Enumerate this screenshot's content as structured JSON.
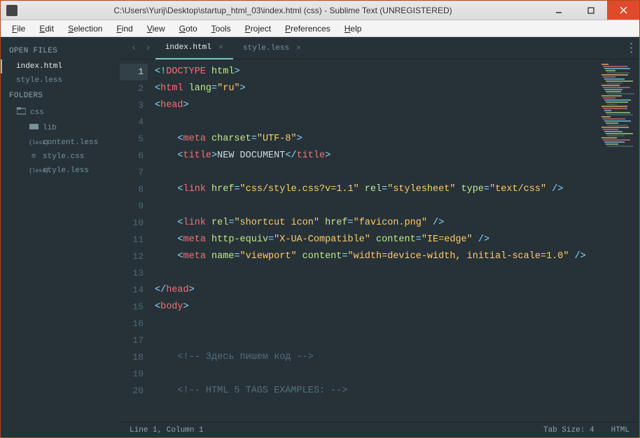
{
  "window": {
    "title": "C:\\Users\\Yurij\\Desktop\\startup_html_03\\index.html (css) - Sublime Text (UNREGISTERED)"
  },
  "menu": [
    "File",
    "Edit",
    "Selection",
    "Find",
    "View",
    "Goto",
    "Tools",
    "Project",
    "Preferences",
    "Help"
  ],
  "sidebar": {
    "open_files_label": "OPEN FILES",
    "open_files": [
      {
        "name": "index.html",
        "active": true
      },
      {
        "name": "style.less",
        "active": false
      }
    ],
    "folders_label": "FOLDERS",
    "tree": [
      {
        "name": "css",
        "icon": "folder-open",
        "indent": 0
      },
      {
        "name": "lib",
        "icon": "folder",
        "indent": 1
      },
      {
        "name": "content.less",
        "icon": "less",
        "indent": 1
      },
      {
        "name": "style.css",
        "icon": "css",
        "indent": 1
      },
      {
        "name": "style.less",
        "icon": "less",
        "indent": 1
      }
    ]
  },
  "tabs": [
    {
      "label": "index.html",
      "active": true
    },
    {
      "label": "style.less",
      "active": false
    }
  ],
  "code_lines": [
    [
      {
        "t": "<!",
        "c": "c-pun"
      },
      {
        "t": "DOCTYPE",
        "c": "c-tag"
      },
      {
        "t": " ",
        "c": ""
      },
      {
        "t": "html",
        "c": "c-attr"
      },
      {
        "t": ">",
        "c": "c-pun"
      }
    ],
    [
      {
        "t": "<",
        "c": "c-pun"
      },
      {
        "t": "html",
        "c": "c-tag"
      },
      {
        "t": " ",
        "c": ""
      },
      {
        "t": "lang",
        "c": "c-attr"
      },
      {
        "t": "=",
        "c": "c-eq"
      },
      {
        "t": "\"ru\"",
        "c": "c-str"
      },
      {
        "t": ">",
        "c": "c-pun"
      }
    ],
    [
      {
        "t": "<",
        "c": "c-pun"
      },
      {
        "t": "head",
        "c": "c-tag"
      },
      {
        "t": ">",
        "c": "c-pun"
      }
    ],
    [
      {
        "t": "",
        "c": ""
      }
    ],
    [
      {
        "t": "    ",
        "c": ""
      },
      {
        "t": "<",
        "c": "c-pun"
      },
      {
        "t": "meta",
        "c": "c-tag"
      },
      {
        "t": " ",
        "c": ""
      },
      {
        "t": "charset",
        "c": "c-attr"
      },
      {
        "t": "=",
        "c": "c-eq"
      },
      {
        "t": "\"UTF-8\"",
        "c": "c-str"
      },
      {
        "t": ">",
        "c": "c-pun"
      }
    ],
    [
      {
        "t": "    ",
        "c": ""
      },
      {
        "t": "<",
        "c": "c-pun"
      },
      {
        "t": "title",
        "c": "c-tag"
      },
      {
        "t": ">",
        "c": "c-pun"
      },
      {
        "t": "NEW DOCUMENT",
        "c": ""
      },
      {
        "t": "</",
        "c": "c-pun"
      },
      {
        "t": "title",
        "c": "c-tag"
      },
      {
        "t": ">",
        "c": "c-pun"
      }
    ],
    [
      {
        "t": "",
        "c": ""
      }
    ],
    [
      {
        "t": "    ",
        "c": ""
      },
      {
        "t": "<",
        "c": "c-pun"
      },
      {
        "t": "link",
        "c": "c-tag"
      },
      {
        "t": " ",
        "c": ""
      },
      {
        "t": "href",
        "c": "c-attr"
      },
      {
        "t": "=",
        "c": "c-eq"
      },
      {
        "t": "\"css/style.css?v=1.1\"",
        "c": "c-str"
      },
      {
        "t": " ",
        "c": ""
      },
      {
        "t": "rel",
        "c": "c-attr"
      },
      {
        "t": "=",
        "c": "c-eq"
      },
      {
        "t": "\"stylesheet\"",
        "c": "c-str"
      },
      {
        "t": " ",
        "c": ""
      },
      {
        "t": "type",
        "c": "c-attr"
      },
      {
        "t": "=",
        "c": "c-eq"
      },
      {
        "t": "\"text/css\"",
        "c": "c-str"
      },
      {
        "t": " />",
        "c": "c-pun"
      }
    ],
    [
      {
        "t": "",
        "c": ""
      }
    ],
    [
      {
        "t": "    ",
        "c": ""
      },
      {
        "t": "<",
        "c": "c-pun"
      },
      {
        "t": "link",
        "c": "c-tag"
      },
      {
        "t": " ",
        "c": ""
      },
      {
        "t": "rel",
        "c": "c-attr"
      },
      {
        "t": "=",
        "c": "c-eq"
      },
      {
        "t": "\"shortcut icon\"",
        "c": "c-str"
      },
      {
        "t": " ",
        "c": ""
      },
      {
        "t": "href",
        "c": "c-attr"
      },
      {
        "t": "=",
        "c": "c-eq"
      },
      {
        "t": "\"favicon.png\"",
        "c": "c-str"
      },
      {
        "t": " />",
        "c": "c-pun"
      }
    ],
    [
      {
        "t": "    ",
        "c": ""
      },
      {
        "t": "<",
        "c": "c-pun"
      },
      {
        "t": "meta",
        "c": "c-tag"
      },
      {
        "t": " ",
        "c": ""
      },
      {
        "t": "http-equiv",
        "c": "c-attr"
      },
      {
        "t": "=",
        "c": "c-eq"
      },
      {
        "t": "\"X-UA-Compatible\"",
        "c": "c-str"
      },
      {
        "t": " ",
        "c": ""
      },
      {
        "t": "content",
        "c": "c-attr"
      },
      {
        "t": "=",
        "c": "c-eq"
      },
      {
        "t": "\"IE=edge\"",
        "c": "c-str"
      },
      {
        "t": " />",
        "c": "c-pun"
      }
    ],
    [
      {
        "t": "    ",
        "c": ""
      },
      {
        "t": "<",
        "c": "c-pun"
      },
      {
        "t": "meta",
        "c": "c-tag"
      },
      {
        "t": " ",
        "c": ""
      },
      {
        "t": "name",
        "c": "c-attr"
      },
      {
        "t": "=",
        "c": "c-eq"
      },
      {
        "t": "\"viewport\"",
        "c": "c-str"
      },
      {
        "t": " ",
        "c": ""
      },
      {
        "t": "content",
        "c": "c-attr"
      },
      {
        "t": "=",
        "c": "c-eq"
      },
      {
        "t": "\"width=device-width, initial-scale=1.0\"",
        "c": "c-str"
      },
      {
        "t": " />",
        "c": "c-pun"
      }
    ],
    [
      {
        "t": "",
        "c": ""
      }
    ],
    [
      {
        "t": "</",
        "c": "c-pun"
      },
      {
        "t": "head",
        "c": "c-tag"
      },
      {
        "t": ">",
        "c": "c-pun"
      }
    ],
    [
      {
        "t": "<",
        "c": "c-pun"
      },
      {
        "t": "body",
        "c": "c-tag"
      },
      {
        "t": ">",
        "c": "c-pun"
      }
    ],
    [
      {
        "t": "",
        "c": ""
      }
    ],
    [
      {
        "t": "",
        "c": ""
      }
    ],
    [
      {
        "t": "    ",
        "c": ""
      },
      {
        "t": "<!-- Здесь пишем код -->",
        "c": "c-comment"
      }
    ],
    [
      {
        "t": "",
        "c": ""
      }
    ],
    [
      {
        "t": "    ",
        "c": ""
      },
      {
        "t": "<!-- HTML 5 TAGS EXAMPLES: -->",
        "c": "c-comment"
      }
    ]
  ],
  "status": {
    "position": "Line 1, Column 1",
    "tab_size": "Tab Size: 4",
    "syntax": "HTML"
  },
  "active_line": 1
}
